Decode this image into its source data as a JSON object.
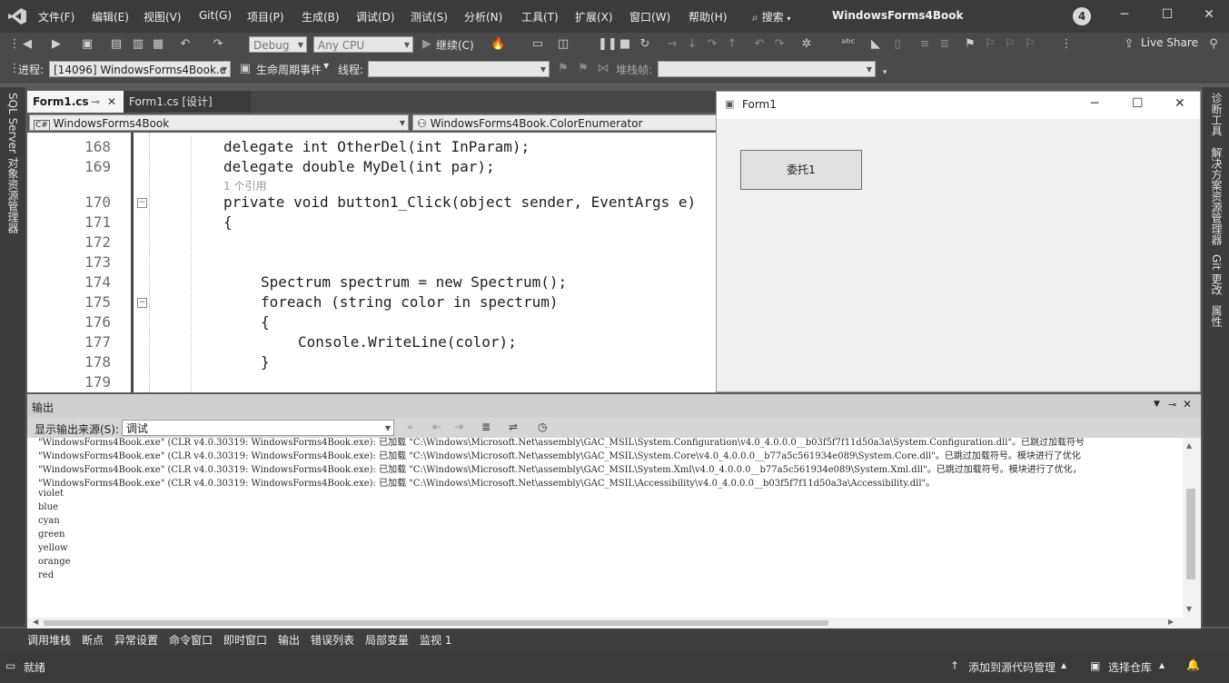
{
  "menu": [
    "文件(F)",
    "编辑(E)",
    "视图(V)",
    "Git(G)",
    "项目(P)",
    "生成(B)",
    "调试(D)",
    "测试(S)",
    "分析(N)",
    "工具(T)",
    "扩展(X)",
    "窗口(W)",
    "帮助(H)"
  ],
  "search_label": "搜索",
  "solution_name": "WindowsForms4Book",
  "notification_count": "4",
  "toolbar": {
    "config": "Debug",
    "platform": "Any CPU",
    "continue_label": "继续(C)",
    "live_share": "Live Share"
  },
  "debug_bar": {
    "process_label": "进程:",
    "process_value": "[14096] WindowsForms4Book.e",
    "lifecycle_label": "生命周期事件",
    "thread_label": "线程:",
    "stack_label": "堆栈帧:"
  },
  "left_sidebar": "SQL Server 对象资源管理器",
  "right_sidebar": [
    "诊断工具",
    "解决方案资源管理器",
    "Git 更改",
    "属性"
  ],
  "doc_tabs": [
    {
      "label": "Form1.cs",
      "active": true
    },
    {
      "label": "Form1.cs [设计]",
      "active": false
    }
  ],
  "nav": {
    "project": "WindowsForms4Book",
    "type": "WindowsForms4Book.ColorEnumerator"
  },
  "code_lens": "1 个引用",
  "code": [
    {
      "num": "168",
      "text": "delegate int OtherDel(int InParam);",
      "indent": 0
    },
    {
      "num": "169",
      "text": "delegate double MyDel(int par);",
      "indent": 0
    },
    {
      "num": "170",
      "text": "private void button1_Click(object sender, EventArgs e)",
      "indent": 0
    },
    {
      "num": "171",
      "text": "{",
      "indent": 0
    },
    {
      "num": "172",
      "text": "",
      "indent": 0
    },
    {
      "num": "173",
      "text": "",
      "indent": 0
    },
    {
      "num": "174",
      "text": "Spectrum spectrum = new Spectrum();",
      "indent": 1
    },
    {
      "num": "175",
      "text": "foreach (string color in spectrum)",
      "indent": 1
    },
    {
      "num": "176",
      "text": "{",
      "indent": 1
    },
    {
      "num": "177",
      "text": "Console.WriteLine(color);",
      "indent": 2
    },
    {
      "num": "178",
      "text": "}",
      "indent": 1
    },
    {
      "num": "179",
      "text": "",
      "indent": 0
    }
  ],
  "form": {
    "title": "Form1",
    "button_label": "委托1"
  },
  "output": {
    "title": "输出",
    "source_label": "显示输出来源(S):",
    "source_value": "调试",
    "lines": [
      "\"WindowsForms4Book.exe\" (CLR v4.0.30319: WindowsForms4Book.exe): 已加载 \"C:\\Windows\\Microsoft.Net\\assembly\\GAC_MSIL\\System.Configuration\\v4.0_4.0.0.0__b03f5f7f11d50a3a\\System.Configuration.dll\"。已跳过加载符号",
      "\"WindowsForms4Book.exe\" (CLR v4.0.30319: WindowsForms4Book.exe): 已加载 \"C:\\Windows\\Microsoft.Net\\assembly\\GAC_MSIL\\System.Core\\v4.0_4.0.0.0__b77a5c561934e089\\System.Core.dll\"。已跳过加载符号。模块进行了优化",
      "\"WindowsForms4Book.exe\" (CLR v4.0.30319: WindowsForms4Book.exe): 已加载 \"C:\\Windows\\Microsoft.Net\\assembly\\GAC_MSIL\\System.Xml\\v4.0_4.0.0.0__b77a5c561934e089\\System.Xml.dll\"。已跳过加载符号。模块进行了优化，",
      "\"WindowsForms4Book.exe\" (CLR v4.0.30319: WindowsForms4Book.exe): 已加载 \"C:\\Windows\\Microsoft.Net\\assembly\\GAC_MSIL\\Accessibility\\v4.0_4.0.0.0__b03f5f7f11d50a3a\\Accessibility.dll\"。",
      "violet",
      "blue",
      "cyan",
      "green",
      "yellow",
      "orange",
      "red"
    ]
  },
  "bottom_tabs": [
    "调用堆栈",
    "断点",
    "异常设置",
    "命令窗口",
    "即时窗口",
    "输出",
    "错误列表",
    "局部变量",
    "监视 1"
  ],
  "status": {
    "ready": "就绪",
    "add_source": "添加到源代码管理",
    "select_repo": "选择仓库"
  }
}
